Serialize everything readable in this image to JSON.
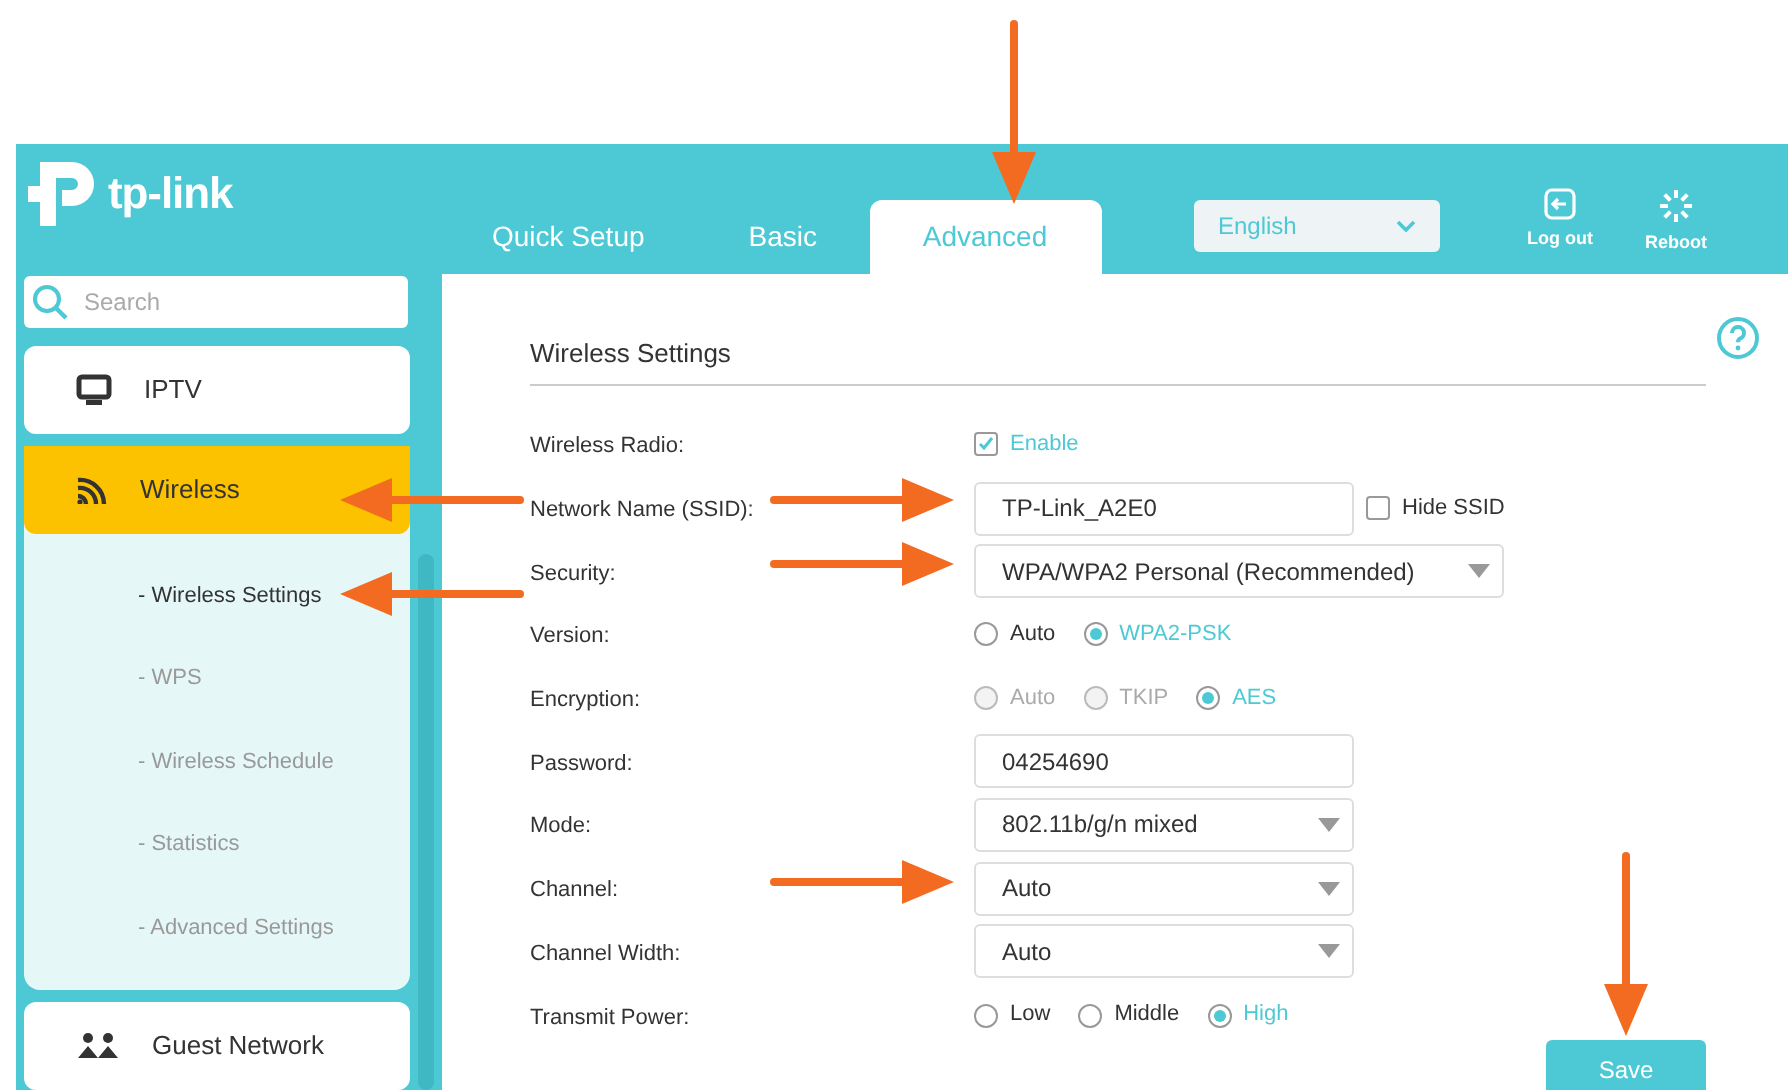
{
  "header": {
    "logo": "tp-link",
    "tabs": [
      {
        "label": "Quick Setup",
        "selected": false
      },
      {
        "label": "Basic",
        "selected": false
      },
      {
        "label": "Advanced",
        "selected": true
      }
    ],
    "language": "English",
    "actions": [
      {
        "kind": "logout",
        "label": "Log out"
      },
      {
        "kind": "reboot",
        "label": "Reboot"
      }
    ]
  },
  "sidebar": {
    "search": {
      "placeholder": "Search"
    },
    "items": [
      {
        "kind": "iptv",
        "label": "IPTV",
        "selected": false
      },
      {
        "kind": "wireless",
        "label": "Wireless",
        "selected": true,
        "children": [
          {
            "label": "- Wireless Settings",
            "selected": true
          },
          {
            "label": "- WPS",
            "selected": false
          },
          {
            "label": "- Wireless Schedule",
            "selected": false
          },
          {
            "label": "- Statistics",
            "selected": false
          },
          {
            "label": "- Advanced Settings",
            "selected": false
          }
        ]
      },
      {
        "kind": "guest",
        "label": "Guest Network",
        "selected": false
      }
    ]
  },
  "form": {
    "title": "Wireless Settings",
    "rows": [
      {
        "kind": "checkbox",
        "label": "Wireless Radio:",
        "option": "Enable",
        "checked": true
      },
      {
        "kind": "text",
        "label": "Network Name (SSID):",
        "value": "TP-Link_A2E0",
        "extra": {
          "label": "Hide SSID",
          "checked": false
        }
      },
      {
        "kind": "select",
        "label": "Security:",
        "value": "WPA/WPA2 Personal (Recommended)",
        "wide": true
      },
      {
        "kind": "radio",
        "label": "Version:",
        "options": [
          {
            "label": "Auto",
            "selected": false
          },
          {
            "label": "WPA2-PSK",
            "selected": true
          }
        ]
      },
      {
        "kind": "radio",
        "label": "Encryption:",
        "options": [
          {
            "label": "Auto",
            "selected": false,
            "disabled": true
          },
          {
            "label": "TKIP",
            "selected": false,
            "disabled": true
          },
          {
            "label": "AES",
            "selected": true,
            "disabled": false
          }
        ]
      },
      {
        "kind": "text",
        "label": "Password:",
        "value": "04254690"
      },
      {
        "kind": "select",
        "label": "Mode:",
        "value": "802.11b/g/n mixed",
        "wide": false
      },
      {
        "kind": "select",
        "label": "Channel:",
        "value": "Auto",
        "wide": false
      },
      {
        "kind": "select",
        "label": "Channel Width:",
        "value": "Auto",
        "wide": false
      },
      {
        "kind": "radio",
        "label": "Transmit Power:",
        "options": [
          {
            "label": "Low",
            "selected": false
          },
          {
            "label": "Middle",
            "selected": false
          },
          {
            "label": "High",
            "selected": true
          }
        ]
      }
    ],
    "save": "Save"
  }
}
